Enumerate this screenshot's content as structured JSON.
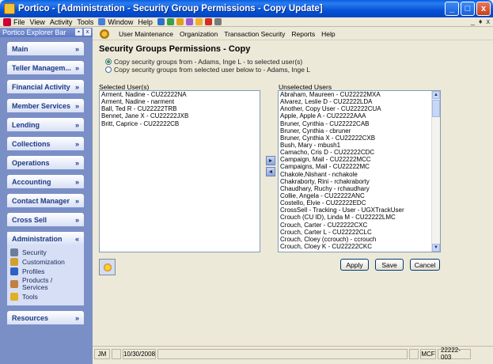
{
  "window": {
    "title": "Portico - [Administration - Security Group Permissions - Copy Update]",
    "buttons": [
      "_",
      "□",
      "x"
    ]
  },
  "menubar": {
    "items": [
      "File",
      "View",
      "Activity",
      "Tools",
      "Window",
      "Help"
    ],
    "mdi_buttons": [
      "_",
      "♦",
      "x"
    ]
  },
  "sidebar": {
    "header": "Portico Explorer Bar",
    "groups": [
      "Main",
      "Teller Managem...",
      "Financial Activity",
      "Member Services",
      "Lending",
      "Collections",
      "Operations",
      "Accounting",
      "Contact Manager",
      "Cross Sell"
    ],
    "expanded": {
      "label": "Administration",
      "items": [
        "Security",
        "Customization",
        "Profiles",
        "Products /\nServices",
        "Tools"
      ]
    },
    "bottom_group": "Resources"
  },
  "main_toolbar": {
    "items": [
      "User Maintenance",
      "Organization",
      "Transaction Security",
      "Reports",
      "Help"
    ]
  },
  "content": {
    "title": "Security Groups Permissions - Copy",
    "radio_options": [
      "Copy security groups from - Adams, Inge L - to selected user(s)",
      "Copy security groups from selected user below to - Adams, Inge L"
    ],
    "selected_label": "Selected User(s)",
    "unselected_label": "Unselected Users",
    "selected_users": [
      "Arment, Nadine - CU22222NA",
      "Arment, Nadine - narment",
      "Ball, Ted R - CU22222TRB",
      "Bennet, Jane X - CU22222JXB",
      "Britt, Caprice - CU22222CB"
    ],
    "unselected_users": [
      "Abraham, Maureen - CU22222MXA",
      "Alvarez, Leslie D - CU22222LDA",
      "Another, Copy User - CU22222CUA",
      "Apple, Apple A - CU22222AAA",
      "Bruner, Cynthia - CU22222CAB",
      "Bruner, Cynthia - cbruner",
      "Bruner, Cynthia X - CU22222CXB",
      "Bush, Mary - mbush1",
      "Camacho, Cris D - CU22222CDC",
      "Campaign, Mail - CU22222MCC",
      "Campaigns, Mail - CU22222MC",
      "Chakole,Nishant - nchakole",
      "Chakraborty, Rini - rchakraborty",
      "Chaudhary, Ruchy - rchaudhary",
      "Collie, Angela - CU22222ANC",
      "Costello, Elvie - CU22222EDC",
      "CrossSell - Tracking - User - UGXTrackUser",
      "Crouch (CU ID), Linda M - CU22222LMC",
      "Crouch, Carter - CU22222CXC",
      "Crouch, Carter L - CU22222CLC",
      "Crouch, Cloey (ccrouch) - ccrouch",
      "Crouch, Cloey K - CU22222CKC"
    ],
    "move_right": "►",
    "move_left": "◄",
    "buttons": {
      "apply": "Apply",
      "save": "Save",
      "cancel": "Cancel"
    }
  },
  "statusbar": {
    "user": "JM",
    "date": "10/30/2008",
    "code": "MCF",
    "id": "22222-003"
  },
  "colors": {
    "titlebar": "#0552d6",
    "sidebar_bg": "#7b8fc7",
    "group_text": "#1f3a85",
    "window_bg": "#ece9d8"
  }
}
